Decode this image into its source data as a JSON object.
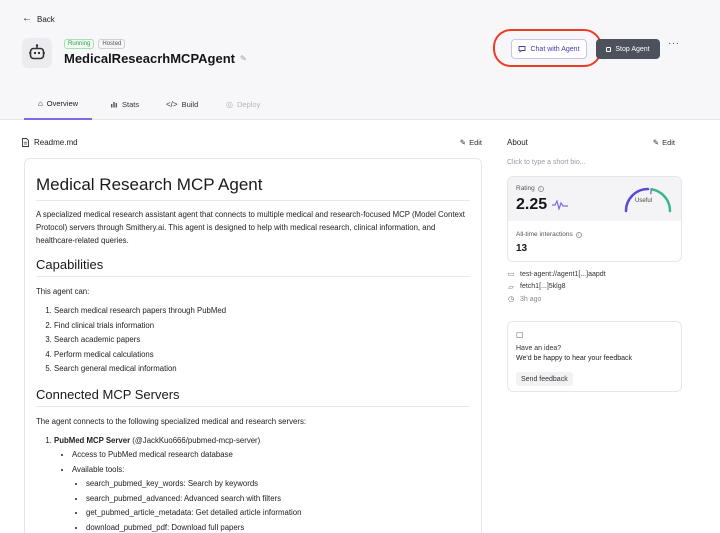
{
  "header": {
    "back_label": "Back",
    "badge_running": "Running",
    "badge_hosted": "Hosted",
    "agent_name": "MedicalReseacrhMCPAgent",
    "chat_button": "Chat with Agent",
    "stop_button": "Stop Agent",
    "more_label": "···"
  },
  "tabs": [
    {
      "label": "Overview",
      "icon": "home-icon",
      "active": true
    },
    {
      "label": "Stats",
      "icon": "bar-chart-icon"
    },
    {
      "label": "Build",
      "icon": "code-icon"
    },
    {
      "label": "Deploy",
      "icon": "globe-icon",
      "disabled": true
    }
  ],
  "readme": {
    "file_label": "Readme.md",
    "edit_label": "Edit",
    "title": "Medical Research MCP Agent",
    "intro": "A specialized medical research assistant agent that connects to multiple medical and research-focused MCP (Model Context Protocol) servers through Smithery.ai. This agent is designed to help with medical research, clinical information, and healthcare-related queries.",
    "capabilities_heading": "Capabilities",
    "capabilities_intro": "This agent can:",
    "capabilities": [
      "Search medical research papers through PubMed",
      "Find clinical trials information",
      "Search academic papers",
      "Perform medical calculations",
      "Search general medical information"
    ],
    "servers_heading": "Connected MCP Servers",
    "servers_intro": "The agent connects to the following specialized medical and research servers:",
    "server1_name": "PubMed MCP Server",
    "server1_id": "(@JackKuo666/pubmed-mcp-server)",
    "server1_items": [
      "Access to PubMed medical research database",
      "Available tools:"
    ],
    "server1_tools": [
      "search_pubmed_key_words: Search by keywords",
      "search_pubmed_advanced: Advanced search with filters",
      "get_pubmed_article_metadata: Get detailed article information",
      "download_pubmed_pdf: Download full papers"
    ]
  },
  "about": {
    "title": "About",
    "edit_label": "Edit",
    "bio_placeholder": "Click to type a short bio...",
    "rating_label": "Rating",
    "rating_value": "2.25",
    "gauge_label": "Useful",
    "gauge_level": 0.55,
    "interactions_label": "All-time interactions",
    "interactions_value": "13",
    "meta": [
      {
        "icon": "id-card-icon",
        "text": "test-agent://agent1[...]aapdt"
      },
      {
        "icon": "folder-icon",
        "text": "fetch1[...]5klg8"
      },
      {
        "icon": "clock-icon",
        "text": "3h ago"
      }
    ]
  },
  "idea": {
    "title": "Have an idea?",
    "subtitle": "We'd be happy to hear your feedback",
    "button": "Send feedback"
  },
  "colors": {
    "accent": "#7b6ce6",
    "highlight": "#ef3b24",
    "running": "#2f9e44",
    "stop_button": "#4d515b"
  }
}
